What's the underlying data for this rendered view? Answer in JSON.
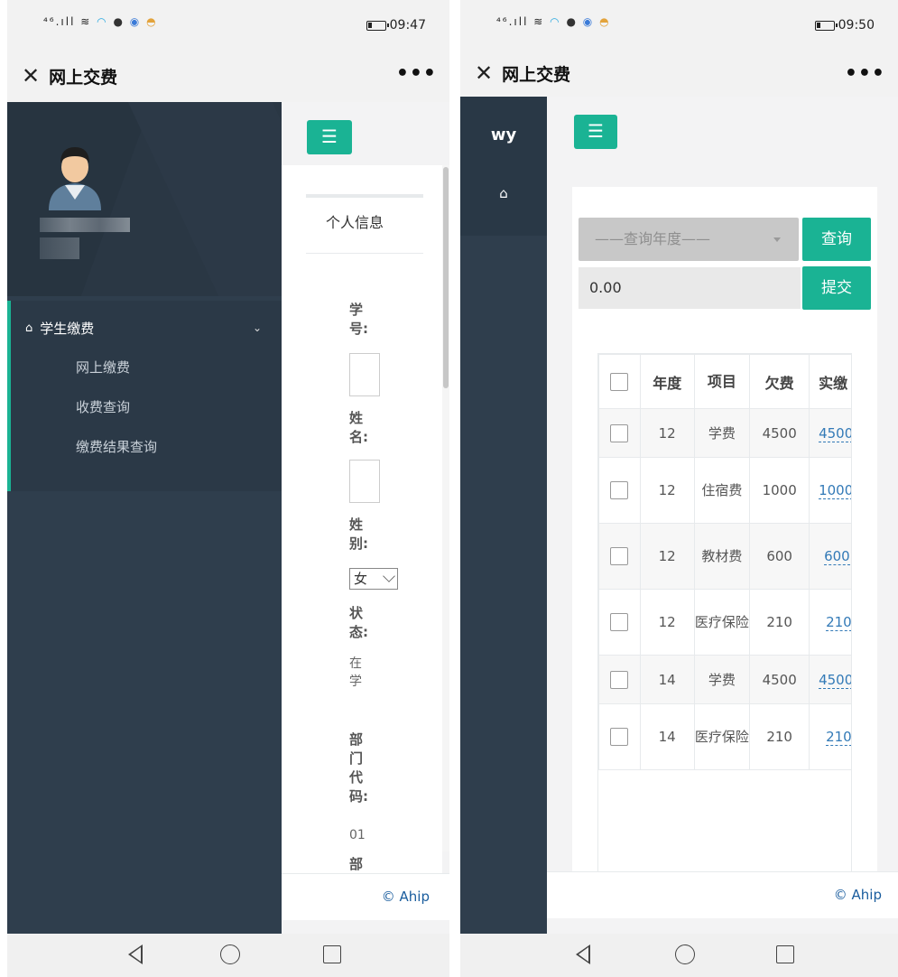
{
  "left": {
    "status": {
      "time": "09:47",
      "network": "4G"
    },
    "title": "网上交费",
    "profile_name_redacted": "1",
    "menu": {
      "section_label": "学生缴费",
      "items": [
        "网上缴费",
        "收费查询",
        "缴费结果查询"
      ]
    },
    "info_title": "个人信息",
    "fields": {
      "student_no_label": "学\n号:",
      "name_label": "姓\n名:",
      "gender_label": "姓\n别:",
      "gender_value": "女",
      "status_label": "状\n态:",
      "status_value": "在\n学",
      "dept_code_label": "部\n门\n代\n码:",
      "dept_code_value": "01",
      "dept_label_partial": "部"
    },
    "footer": "© Ahip"
  },
  "right": {
    "status": {
      "time": "09:50",
      "network": "4G"
    },
    "title": "网上交费",
    "brand": "wy",
    "year_placeholder": "——查询年度——",
    "query_button": "查询",
    "amount_value": "0.00",
    "submit_button": "提交",
    "table": {
      "headers": [
        "年度",
        "项目",
        "欠费",
        "实缴"
      ],
      "rows": [
        {
          "year": "12",
          "item": "学费",
          "owe": "4500",
          "paid": "4500"
        },
        {
          "year": "12",
          "item": "住宿费",
          "owe": "1000",
          "paid": "1000"
        },
        {
          "year": "12",
          "item": "教材费",
          "owe": "600",
          "paid": "600"
        },
        {
          "year": "12",
          "item": "医疗保险",
          "owe": "210",
          "paid": "210"
        },
        {
          "year": "14",
          "item": "学费",
          "owe": "4500",
          "paid": "4500"
        },
        {
          "year": "14",
          "item": "医疗保险",
          "owe": "210",
          "paid": "210"
        }
      ]
    },
    "footer": "© Ahip"
  },
  "colors": {
    "accent_green": "#1ab394",
    "sidebar_dark": "#2f3e4d",
    "link_blue": "#337ab7"
  },
  "icons": [
    "close-icon",
    "more-icon",
    "home-icon",
    "menu-icon",
    "chevron-down-icon",
    "back-icon",
    "circle-home-icon",
    "square-recent-icon",
    "battery-icon",
    "wifi-icon"
  ]
}
